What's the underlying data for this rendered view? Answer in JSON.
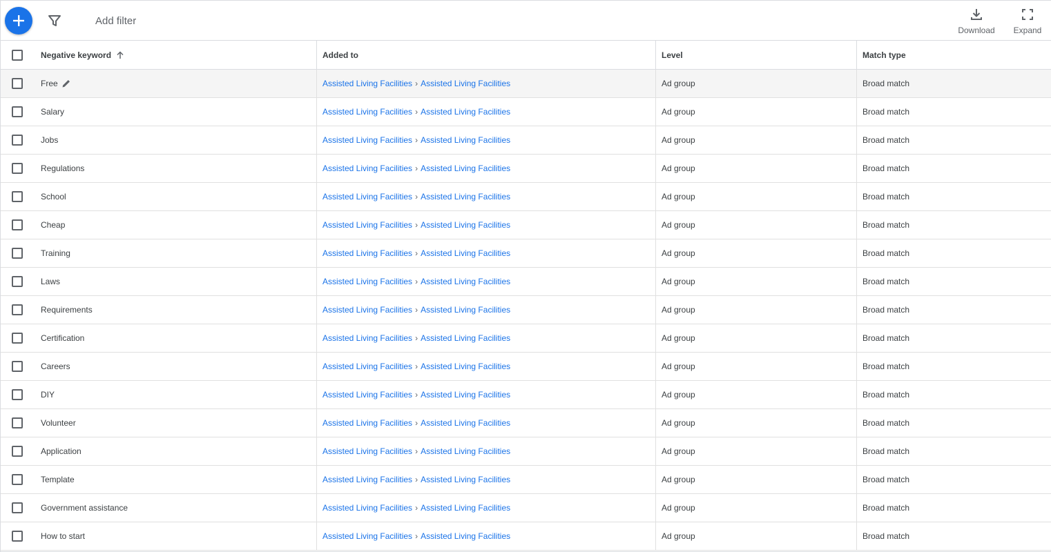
{
  "toolbar": {
    "add_filter": "Add filter",
    "download_label": "Download",
    "expand_label": "Expand"
  },
  "columns": {
    "keyword": "Negative keyword",
    "added_to": "Added to",
    "level": "Level",
    "match_type": "Match type"
  },
  "colors": {
    "accent": "#1a73e8",
    "border": "#dadce0",
    "text": "#3c4043"
  },
  "rows": [
    {
      "keyword": "Free",
      "campaign": "Assisted Living Facilities",
      "separator": "›",
      "ad_group": "Assisted Living Facilities",
      "level": "Ad group",
      "match": "Broad match"
    },
    {
      "keyword": "Salary",
      "campaign": "Assisted Living Facilities",
      "separator": "›",
      "ad_group": "Assisted Living Facilities",
      "level": "Ad group",
      "match": "Broad match"
    },
    {
      "keyword": "Jobs",
      "campaign": "Assisted Living Facilities",
      "separator": "›",
      "ad_group": "Assisted Living Facilities",
      "level": "Ad group",
      "match": "Broad match"
    },
    {
      "keyword": "Regulations",
      "campaign": "Assisted Living Facilities",
      "separator": "›",
      "ad_group": "Assisted Living Facilities",
      "level": "Ad group",
      "match": "Broad match"
    },
    {
      "keyword": "School",
      "campaign": "Assisted Living Facilities",
      "separator": "›",
      "ad_group": "Assisted Living Facilities",
      "level": "Ad group",
      "match": "Broad match"
    },
    {
      "keyword": "Cheap",
      "campaign": "Assisted Living Facilities",
      "separator": "›",
      "ad_group": "Assisted Living Facilities",
      "level": "Ad group",
      "match": "Broad match"
    },
    {
      "keyword": "Training",
      "campaign": "Assisted Living Facilities",
      "separator": "›",
      "ad_group": "Assisted Living Facilities",
      "level": "Ad group",
      "match": "Broad match"
    },
    {
      "keyword": "Laws",
      "campaign": "Assisted Living Facilities",
      "separator": "›",
      "ad_group": "Assisted Living Facilities",
      "level": "Ad group",
      "match": "Broad match"
    },
    {
      "keyword": "Requirements",
      "campaign": "Assisted Living Facilities",
      "separator": "›",
      "ad_group": "Assisted Living Facilities",
      "level": "Ad group",
      "match": "Broad match"
    },
    {
      "keyword": "Certification",
      "campaign": "Assisted Living Facilities",
      "separator": "›",
      "ad_group": "Assisted Living Facilities",
      "level": "Ad group",
      "match": "Broad match"
    },
    {
      "keyword": "Careers",
      "campaign": "Assisted Living Facilities",
      "separator": "›",
      "ad_group": "Assisted Living Facilities",
      "level": "Ad group",
      "match": "Broad match"
    },
    {
      "keyword": "DIY",
      "campaign": "Assisted Living Facilities",
      "separator": "›",
      "ad_group": "Assisted Living Facilities",
      "level": "Ad group",
      "match": "Broad match"
    },
    {
      "keyword": "Volunteer",
      "campaign": "Assisted Living Facilities",
      "separator": "›",
      "ad_group": "Assisted Living Facilities",
      "level": "Ad group",
      "match": "Broad match"
    },
    {
      "keyword": "Application",
      "campaign": "Assisted Living Facilities",
      "separator": "›",
      "ad_group": "Assisted Living Facilities",
      "level": "Ad group",
      "match": "Broad match"
    },
    {
      "keyword": "Template",
      "campaign": "Assisted Living Facilities",
      "separator": "›",
      "ad_group": "Assisted Living Facilities",
      "level": "Ad group",
      "match": "Broad match"
    },
    {
      "keyword": "Government assistance",
      "campaign": "Assisted Living Facilities",
      "separator": "›",
      "ad_group": "Assisted Living Facilities",
      "level": "Ad group",
      "match": "Broad match"
    },
    {
      "keyword": "How to start",
      "campaign": "Assisted Living Facilities",
      "separator": "›",
      "ad_group": "Assisted Living Facilities",
      "level": "Ad group",
      "match": "Broad match"
    }
  ]
}
